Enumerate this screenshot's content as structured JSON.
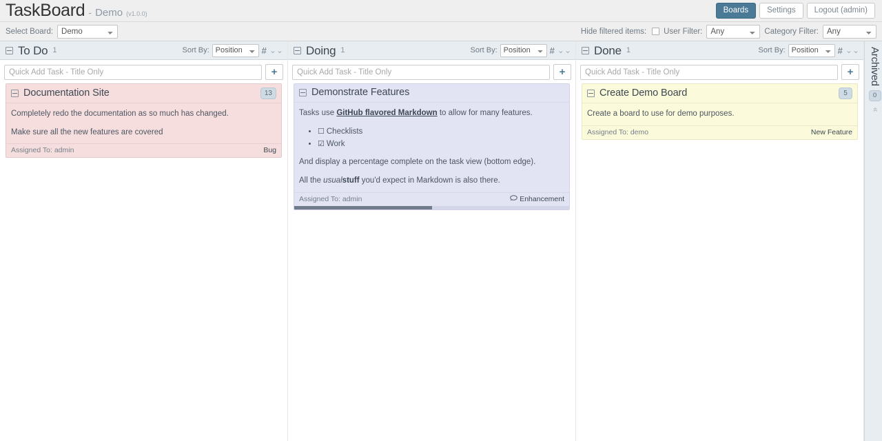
{
  "header": {
    "app_title": "TaskBoard",
    "dash": "-",
    "board_name": "Demo",
    "version": "(v1.0.0)",
    "nav": [
      {
        "label": "Boards",
        "active": true
      },
      {
        "label": "Settings",
        "active": false
      },
      {
        "label": "Logout (admin)",
        "active": false
      }
    ]
  },
  "filterbar": {
    "select_board_label": "Select Board:",
    "select_board_value": "Demo",
    "hide_filtered_label": "Hide filtered items:",
    "hide_filtered_checked": false,
    "user_filter_label": "User Filter:",
    "user_filter_value": "Any",
    "category_filter_label": "Category Filter:",
    "category_filter_value": "Any"
  },
  "common": {
    "sort_by_label": "Sort By:",
    "sort_by_value": "Position",
    "quick_add_placeholder": "Quick Add Task - Title Only",
    "add_button_label": "+",
    "hash_icon": "#",
    "chevron_icon": "»"
  },
  "columns": [
    {
      "name": "To Do",
      "count": "1",
      "sort_by_value": "Position",
      "cards": [
        {
          "title": "Documentation Site",
          "badge": "13",
          "color": "pink",
          "lines": [
            "Completely redo the documentation as so much has changed.",
            "Make sure all the new features are covered"
          ],
          "assigned": "Assigned To: admin",
          "category": "Bug",
          "has_category_icon": false,
          "progress": null
        }
      ]
    },
    {
      "name": "Doing",
      "count": "1",
      "sort_by_value": "Position",
      "cards": [
        {
          "title": "Demonstrate Features",
          "badge": null,
          "color": "blue",
          "line1_pre": "Tasks use ",
          "line1_link": "GitHub flavored Markdown",
          "line1_post": " to allow for many features.",
          "checklist": [
            {
              "label": "Checklists",
              "checked": false
            },
            {
              "label": "Work",
              "checked": true
            }
          ],
          "line2": "And display a percentage complete on the task view (bottom edge).",
          "line3_pre": "All the ",
          "line3_em": "usual",
          "line3_strong": "stuff",
          "line3_post": " you'd expect in Markdown is also there.",
          "assigned": "Assigned To: admin",
          "category": "Enhancement",
          "has_category_icon": true,
          "progress": 50
        }
      ]
    },
    {
      "name": "Done",
      "count": "1",
      "sort_by_value": "Position",
      "cards": [
        {
          "title": "Create Demo Board",
          "badge": "5",
          "color": "yellow",
          "lines": [
            "Create a board to use for demo purposes."
          ],
          "assigned": "Assigned To: demo",
          "category": "New Feature",
          "has_category_icon": false,
          "progress": null
        }
      ]
    }
  ],
  "archived": {
    "label": "Archived",
    "badge": "0",
    "chevron": "»"
  },
  "checkbox_glyphs": {
    "unchecked": "☐",
    "checked": "☑"
  },
  "colors": {
    "accent": "#4a7a96",
    "card_pink": "#f6dedf",
    "card_blue": "#e2e4f4",
    "card_yellow": "#fbfada",
    "column_header": "#e8edf1"
  }
}
